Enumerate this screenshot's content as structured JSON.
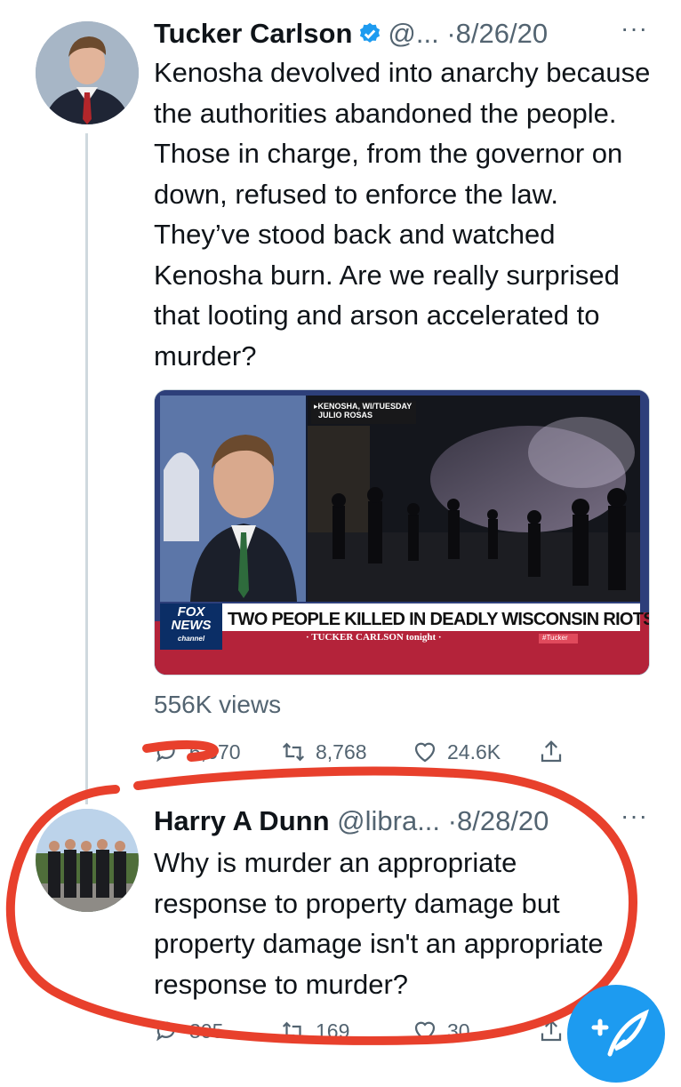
{
  "tweets": [
    {
      "name": "Tucker Carlson",
      "handle": "@...",
      "dot": "·",
      "date": "8/26/20",
      "more": "···",
      "text": "Kenosha devolved into anarchy because the authorities abandoned the people. Those in charge, from the governor on down, refused to enforce the law. They’ve stood back and watched Kenosha burn. Are we really surprised that looting and arson accelerated to murder?",
      "views": "556K views",
      "replies": "6,670",
      "retweets": "8,768",
      "likes": "24.6K",
      "media": {
        "location": "KENOSHA, WI/TUESDAY",
        "reporter": "JULIO ROSAS",
        "logo_line1": "FOX",
        "logo_line2": "NEWS",
        "logo_line3": "channel",
        "headline": "TWO PEOPLE KILLED IN DEADLY WISCONSIN RIOTS",
        "show": "· TUCKER CARLSON tonight ·",
        "hashtag": "#Tucker"
      }
    },
    {
      "name": "Harry A Dunn",
      "handle": "@libra...",
      "dot": "·",
      "date": "8/28/20",
      "more": "···",
      "text": "Why is murder an appropriate response to property damage but property damage isn't an appropriate response to murder?",
      "replies": "305",
      "retweets": "169",
      "likes": "30"
    }
  ],
  "colors": {
    "accent": "#1d9bf0",
    "annotation": "#e8402c",
    "muted": "#536471"
  },
  "icons": [
    "verified-badge-icon",
    "reply-icon",
    "retweet-icon",
    "like-icon",
    "share-icon",
    "compose-tweet-icon"
  ]
}
